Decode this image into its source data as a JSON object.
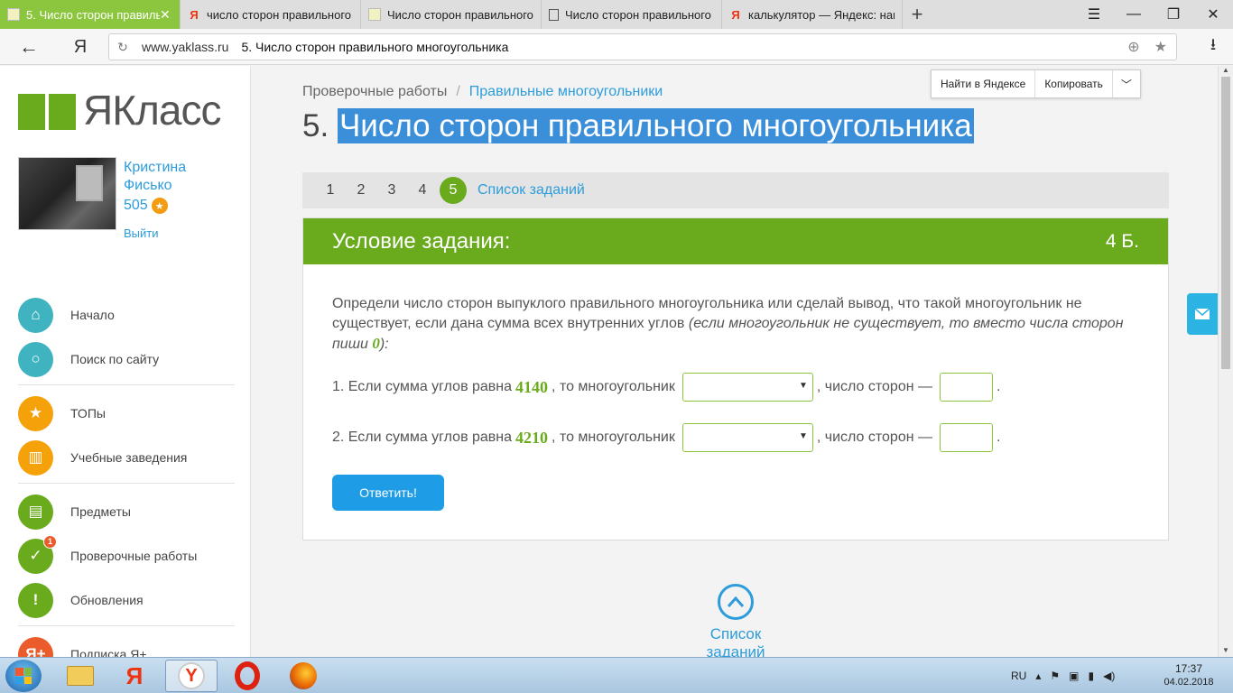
{
  "browser": {
    "tabs": [
      {
        "title": "5. Число сторон правиль",
        "icon": "yaklass-favicon",
        "active": true
      },
      {
        "title": "число сторон правильного",
        "icon": "yandex-favicon",
        "active": false
      },
      {
        "title": "Число сторон правильного",
        "icon": "green-favicon",
        "active": false
      },
      {
        "title": "Число сторон правильного",
        "icon": "document-favicon",
        "active": false
      },
      {
        "title": "калькулятор — Яндекс: нащ",
        "icon": "yandex-favicon",
        "active": false
      }
    ],
    "address": {
      "domain": "www.yaklass.ru",
      "page_title": "5. Число сторон правильного многоугольника"
    },
    "accent_color": "#8cc63e"
  },
  "sidebar": {
    "logo_text": "ЯКласс",
    "user": {
      "first_name": "Кристина",
      "last_name": "Фисько",
      "coins": "505",
      "logout": "Выйти"
    },
    "menu": [
      {
        "label": "Начало",
        "icon": "home-icon",
        "color": "#3fb3bf"
      },
      {
        "label": "Поиск по сайту",
        "icon": "search-icon",
        "color": "#3fb3bf"
      },
      {
        "label": "ТОПы",
        "icon": "star-icon",
        "color": "#f5a10a"
      },
      {
        "label": "Учебные заведения",
        "icon": "institution-icon",
        "color": "#f5a10a"
      },
      {
        "label": "Предметы",
        "icon": "book-icon",
        "color": "#6aab1e"
      },
      {
        "label": "Проверочные работы",
        "icon": "check-icon",
        "color": "#6aab1e",
        "badge": "1"
      },
      {
        "label": "Обновления",
        "icon": "exclamation-icon",
        "color": "#6aab1e"
      },
      {
        "label": "Подписка Я+",
        "icon": "subscription-icon",
        "color": "#ea5c2c"
      }
    ]
  },
  "main": {
    "breadcrumb": {
      "root": "Проверочные работы",
      "separator": "/",
      "current": "Правильные многоугольники"
    },
    "title_number": "5.",
    "title_text": "Число сторон правильного многоугольника",
    "selection_popup": {
      "find": "Найти в Яндексе",
      "copy": "Копировать"
    },
    "task_nav": {
      "items": [
        "1",
        "2",
        "3",
        "4",
        "5"
      ],
      "active": "5",
      "list_link": "Список заданий"
    },
    "task": {
      "header": "Условие задания:",
      "points": "4 Б.",
      "text_main": "Определи число сторон выпуклого правильного многоугольника или сделай вывод, что такой многоугольник не существует, если дана сумма всех внутренних углов ",
      "text_italic_start": "(если многоугольник не существует, то вместо числа сторон пиши ",
      "text_italic_zero": "0",
      "text_italic_end": "):",
      "questions": [
        {
          "prefix": "1. Если сумма углов равна",
          "value": "4140",
          "middle": ", то многоугольник",
          "after_select": ", число сторон —",
          "end": "."
        },
        {
          "prefix": "2. Если сумма углов равна",
          "value": "4210",
          "middle": ", то многоугольник",
          "after_select": ", число сторон —",
          "end": "."
        }
      ],
      "answer_button": "Ответить!"
    },
    "bottom_link": "Список заданий"
  },
  "taskbar": {
    "language": "RU",
    "time": "17:37",
    "date": "04.02.2018"
  }
}
